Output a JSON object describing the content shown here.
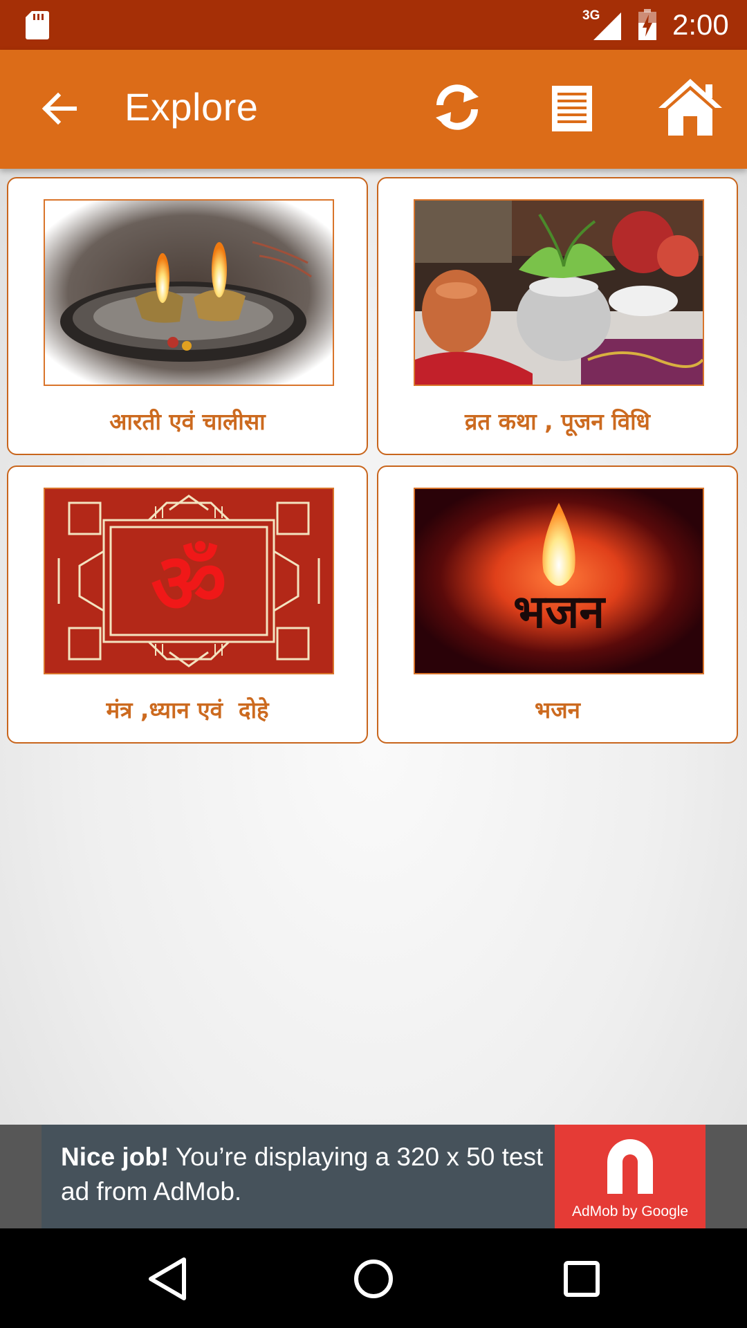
{
  "status_bar": {
    "network": "3G",
    "time": "2:00",
    "icons": [
      "sd-card-icon",
      "signal-icon",
      "battery-charging-icon"
    ]
  },
  "app_bar": {
    "title": "Explore",
    "icons": [
      "back-arrow-icon",
      "refresh-icon",
      "list-icon",
      "home-icon"
    ]
  },
  "cards": [
    {
      "label": "आरती एवं चालीसा",
      "image": "diya-lamps-image"
    },
    {
      "label": "व्रत कथा , पूजन विधि",
      "image": "kalash-puja-image"
    },
    {
      "label": "मंत्र ,ध्यान एवं  दोहे",
      "image": "om-rangoli-image"
    },
    {
      "label": "भजन",
      "image": "bhajan-flame-image"
    }
  ],
  "ad": {
    "headline": "Nice job!",
    "body": " You’re displaying a 320 x 50 test ad from AdMob.",
    "logo_caption": "AdMob by Google"
  },
  "colors": {
    "status_bar": "#a52f06",
    "app_bar": "#dc6c18",
    "accent_text": "#cc6a1f",
    "ad_background": "#46525b",
    "ad_logo": "#e53b36"
  },
  "nav_bar": {
    "icons": [
      "nav-back-icon",
      "nav-home-icon",
      "nav-recents-icon"
    ]
  }
}
